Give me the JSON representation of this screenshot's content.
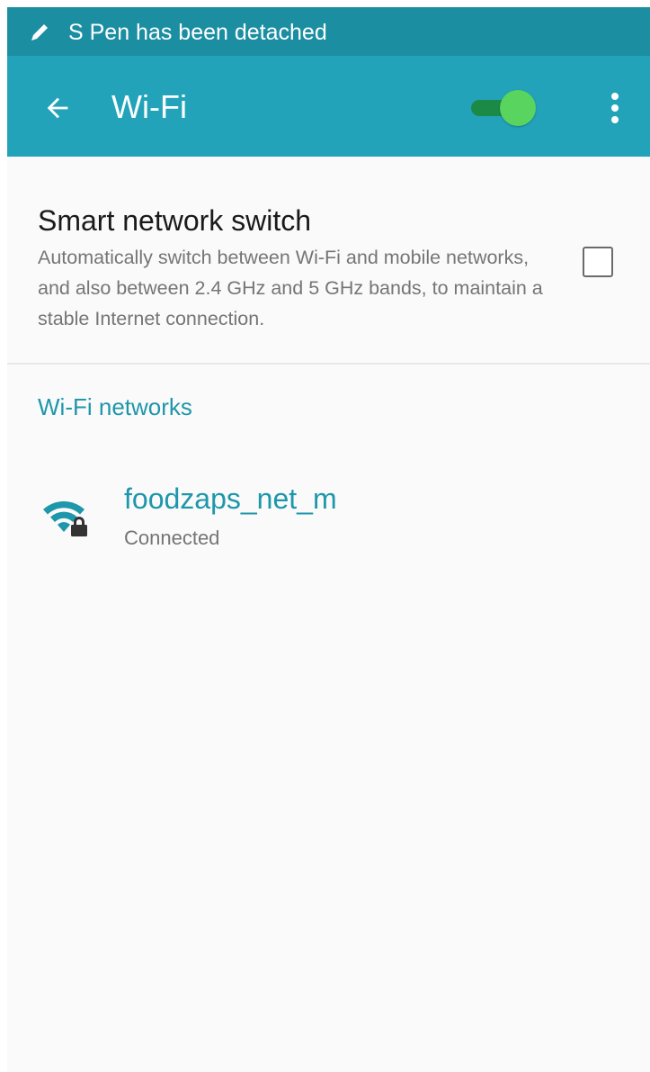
{
  "status_bar": {
    "notification_text": "S Pen has been detached",
    "icon": "pen-icon"
  },
  "app_bar": {
    "title": "Wi-Fi",
    "back_icon": "arrow-left-icon",
    "wifi_toggle_on": true,
    "overflow_icon": "more-vert-icon",
    "background_color": "#22a3b9"
  },
  "smart_switch": {
    "title": "Smart network switch",
    "description": "Automatically switch between Wi-Fi and mobile networks, and also between 2.4 GHz and 5 GHz bands, to maintain a stable Internet connection.",
    "checked": false
  },
  "networks_section": {
    "header": "Wi-Fi networks",
    "items": [
      {
        "name": "foodzaps_net_m",
        "status": "Connected",
        "icon": "wifi-lock-icon"
      }
    ]
  },
  "colors": {
    "accent": "#1e97ab",
    "status_bar": "#1b8ea2",
    "toggle_on": "#58d45f"
  }
}
